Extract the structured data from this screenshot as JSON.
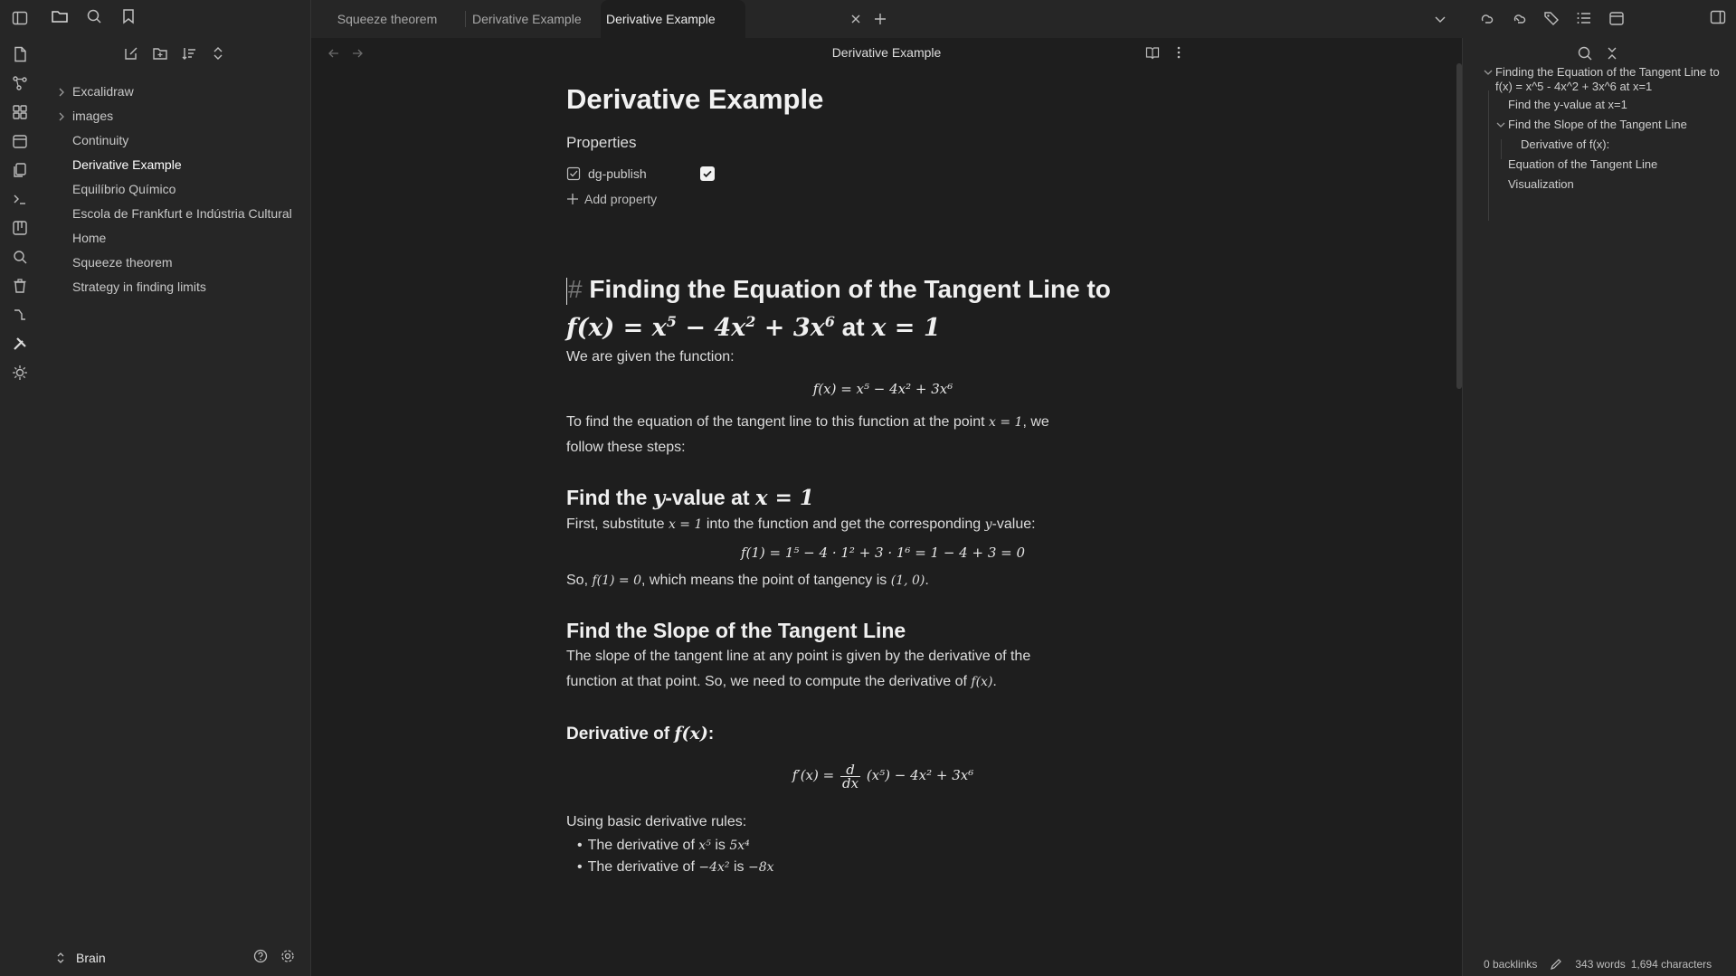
{
  "tabs": [
    {
      "label": "Squeeze theorem"
    },
    {
      "label": "Derivative Example"
    },
    {
      "label": "Derivative Example"
    }
  ],
  "file_tree": [
    {
      "label": "Excalidraw",
      "folder": true
    },
    {
      "label": "images",
      "folder": true
    },
    {
      "label": "Continuity",
      "folder": false
    },
    {
      "label": "Derivative Example",
      "folder": false,
      "active": true
    },
    {
      "label": "Equilíbrio Químico",
      "folder": false
    },
    {
      "label": "Escola de Frankfurt e Indústria Cultural",
      "folder": false
    },
    {
      "label": "Home",
      "folder": false
    },
    {
      "label": "Squeeze theorem",
      "folder": false
    },
    {
      "label": "Strategy in finding limits",
      "folder": false
    }
  ],
  "vault": {
    "name": "Brain"
  },
  "view": {
    "title": "Derivative Example"
  },
  "note": {
    "title": "Derivative Example",
    "properties_label": "Properties",
    "property": {
      "name": "dg-publish",
      "checked": true
    },
    "add_property": "Add property",
    "h1_hash": "#",
    "h1_text": "Finding the Equation of the Tangent Line to",
    "h1_math_a": "f(x) = x",
    "h1_math_b": " − 4x",
    "h1_math_c": " + 3x",
    "h1_at": "at",
    "h1_math_d": "x = 1",
    "p1": "We are given the function:",
    "eq1": "f(x) = x⁵ − 4x² + 3x⁶",
    "p2a": "To find the equation of the tangent line to this function at the point",
    "p2m": "x = 1",
    "p2b": ", we follow these steps:",
    "h2a_1": "Find the",
    "h2a_m1": "y",
    "h2a_2": "-value at",
    "h2a_m2": "x = 1",
    "p3a": "First, substitute",
    "p3m1": "x = 1",
    "p3b": "into the function and get the corresponding",
    "p3m2": "y",
    "p3c": "-value:",
    "eq2": "f(1) = 1⁵ − 4 · 1² + 3 · 1⁶ = 1 − 4 + 3 = 0",
    "p4a": "So,",
    "p4m1": "f(1) = 0",
    "p4b": ", which means the point of tangency is",
    "p4m2": "(1, 0)",
    "p4c": ".",
    "h2b": "Find the Slope of the Tangent Line",
    "p5a": "The slope of the tangent line at any point is given by the derivative of the function at that point. So, we need to compute the derivative of",
    "p5m": "f(x)",
    "p5b": ".",
    "h3_1": "Derivative of",
    "h3_m": "f(x)",
    "h3_2": ":",
    "eq3_left": "f′(x) =",
    "eq3_num": "d",
    "eq3_den": "dx",
    "eq3_right": "(x⁵) − 4x² + 3x⁶",
    "p6": "Using basic derivative rules:",
    "b1a": "The derivative of",
    "b1m1": "x⁵",
    "b1b": "is",
    "b1m2": "5x⁴",
    "b2a": "The derivative of",
    "b2m1": "−4x²",
    "b2b": "is",
    "b2m2": "−8x"
  },
  "outline": [
    {
      "label": "Finding the Equation of the Tangent Line to f(x) = x^5 - 4x^2 + 3x^6 at x=1",
      "level": 1,
      "collapsible": true
    },
    {
      "label": "Find the y-value at x=1",
      "level": 2
    },
    {
      "label": "Find the Slope of the Tangent Line",
      "level": 2,
      "collapsible": true
    },
    {
      "label": "Derivative of f(x):",
      "level": 3
    },
    {
      "label": "Equation of the Tangent Line",
      "level": 2
    },
    {
      "label": "Visualization",
      "level": 2
    }
  ],
  "status": {
    "backlinks": "0 backlinks",
    "words": "343 words",
    "characters": "1,694 characters"
  }
}
